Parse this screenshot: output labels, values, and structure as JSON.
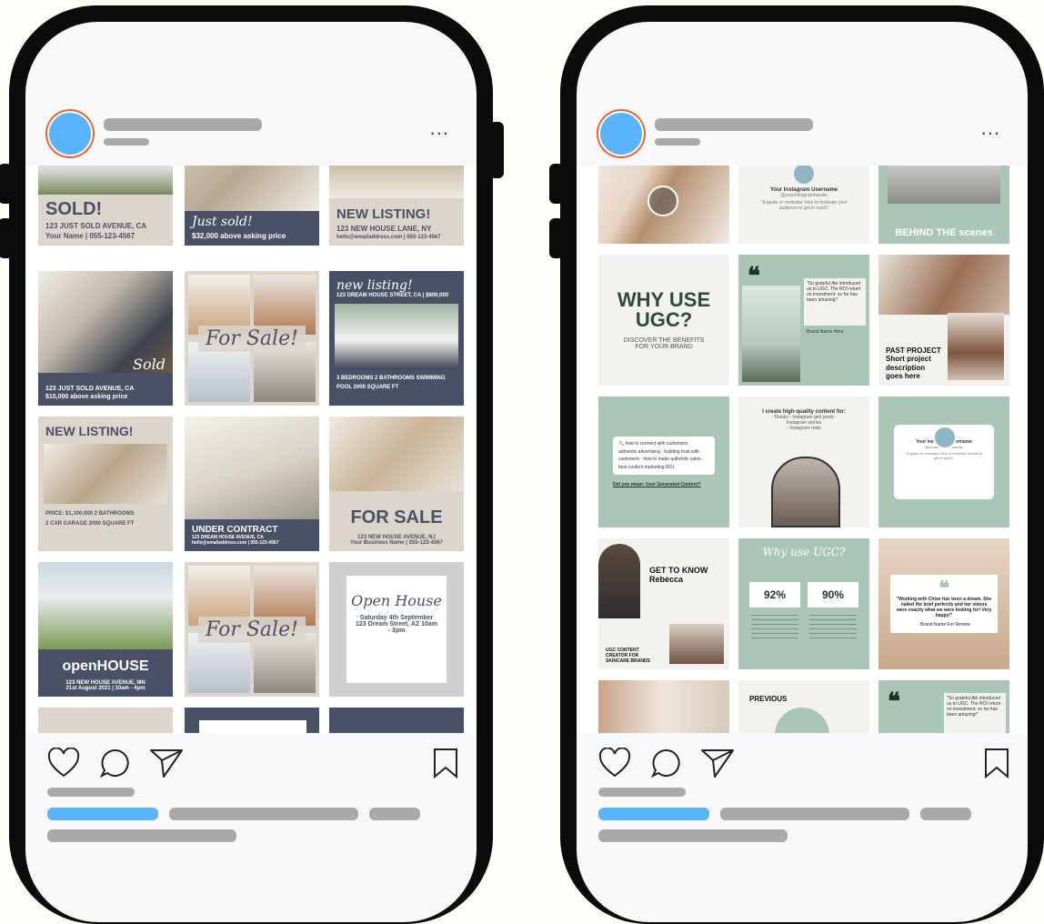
{
  "left_post": {
    "more_label": "...",
    "tiles": [
      {
        "title": "SOLD!",
        "sub": "123 JUST SOLD AVENUE, CA",
        "line3": "Your Name | 055-123-4567"
      },
      {
        "title": "Just sold!",
        "sub": "$32,000 above asking price",
        "line3": ""
      },
      {
        "title": "NEW LISTING!",
        "sub": "123 NEW HOUSE LANE, NY",
        "line3": "hello@emailaddress.com | 055-123-4567"
      },
      {
        "title": "Sold",
        "sub": "123 JUST SOLD AVENUE, CA",
        "line3": "$15,000 above asking price"
      },
      {
        "title": "For Sale!",
        "sub": "",
        "line3": ""
      },
      {
        "title": "new listing!",
        "sub": "123 DREAM HOUSE STREET, CA | $800,000",
        "line3": "3 BEDROOMS   2 BATHROOMS   SWIMMING POOL   2000 SQUARE FT"
      },
      {
        "title": "NEW LISTING!",
        "sub": "PRICE: $1,100,000   2 BATHROOMS",
        "line3": "2 CAR GARAGE   2000 SQUARE FT"
      },
      {
        "title": "UNDER CONTRACT",
        "sub": "123 DREAM HOUSE AVENUE, CA",
        "line3": "hello@emailaddress.com | 055-123-4567"
      },
      {
        "title": "FOR SALE",
        "sub": "123 NEW HOUSE AVENUE, NJ",
        "line3": "Your Business Name | 055-123-4567"
      },
      {
        "title": "openHOUSE",
        "sub": "123 NEW HOUSE AVENUE, MN",
        "line3": "21st August 2021 | 10am - 4pm"
      },
      {
        "title": "For Sale!",
        "sub": "",
        "line3": ""
      },
      {
        "title": "Open House",
        "sub": "Saturday 4th September",
        "line3": "123 Dream Street, AZ   10am - 3pm"
      }
    ]
  },
  "right_post": {
    "more_label": "...",
    "tiles": [
      {
        "title": "",
        "sub": "",
        "line3": ""
      },
      {
        "title": "Your Instagram Username",
        "sub": "@yourinstagramhandle",
        "line3": "\"A quote or motivator here to motivate your audience to get in touch\""
      },
      {
        "title": "BEHIND THE scenes",
        "sub": "",
        "line3": ""
      },
      {
        "title": "WHY USE UGC?",
        "sub": "DISCOVER THE BENEFITS",
        "line3": "FOR YOUR BRAND"
      },
      {
        "title": "\"So grateful Abi introduced us to UGC. The ROI return on investment: so far has been amazing!\"",
        "sub": "- Brand Name Here",
        "line3": ""
      },
      {
        "title": "PAST PROJECT",
        "sub": "Short project description",
        "line3": "goes here"
      },
      {
        "title": "how to connect with customers",
        "sub": "authentic advertising · building trust with customers · how to make authentic sales · best content marketing ROI",
        "line3": "Did you mean: User Generated Content?"
      },
      {
        "title": "I create high-quality content for:",
        "sub": "- Tiktoks - Instagram grid posts - Instagram stories",
        "line3": "- Instagram reels"
      },
      {
        "title": "Your Instagram Username",
        "sub": "@yourinstagramhandle",
        "line3": "\"A quote or motivator here to motivate brands to get in touch\""
      },
      {
        "title": "GET TO KNOW Rebecca",
        "sub": "UGC CONTENT CREATOR FOR",
        "line3": "SKINCARE BRANDS"
      },
      {
        "title": "Why use UGC?",
        "sub": "92%",
        "line3": "90%"
      },
      {
        "title": "\"Working with Chloe has been a dream. She nailed the brief perfectly and her videos were exactly what we were looking for! Very happy!\"",
        "sub": "- Brand Name For Review",
        "line3": ""
      }
    ],
    "partial": [
      {
        "title": "PREVIOUS"
      },
      {
        "title": "\"So grateful Abi introduced us to UGC. The ROI return on investment: so far has been amazing!\""
      }
    ]
  },
  "colors": {
    "accent": "#5ab4fb",
    "avatar_ring": "#e8642a",
    "navy": "#4a5166",
    "beige": "#dcd5cb",
    "sage": "#a9c6b7",
    "placeholder": "#a9a9a9"
  },
  "icons": [
    "heart-icon",
    "comment-icon",
    "send-icon",
    "bookmark-icon",
    "more-dots-icon"
  ]
}
